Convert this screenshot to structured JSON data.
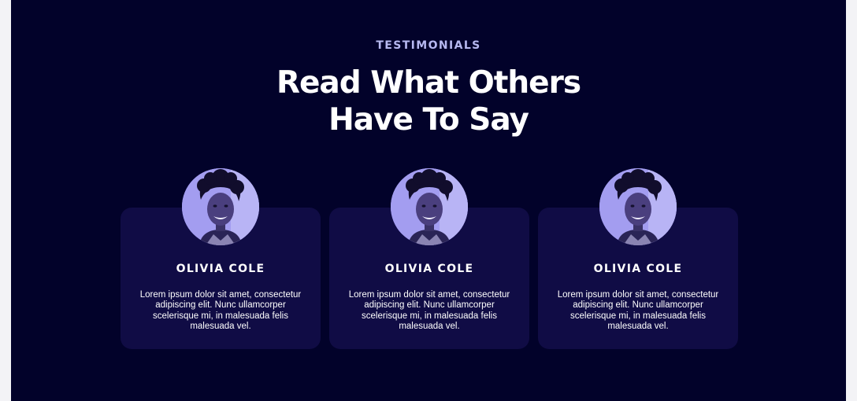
{
  "testimonials": {
    "eyebrow": "TESTIMONIALS",
    "headline_line1": "Read What Others",
    "headline_line2": "Have To Say",
    "items": [
      {
        "name": "OLIVIA COLE",
        "text": "Lorem ipsum dolor sit amet, consectetur adipiscing elit. Nunc ullamcorper scelerisque mi, in malesuada felis malesuada vel."
      },
      {
        "name": "OLIVIA COLE",
        "text": "Lorem ipsum dolor sit amet, consectetur adipiscing elit. Nunc ullamcorper scelerisque mi, in malesuada felis malesuada vel."
      },
      {
        "name": "OLIVIA COLE",
        "text": "Lorem ipsum dolor sit amet, consectetur adipiscing elit. Nunc ullamcorper scelerisque mi, in malesuada felis malesuada vel."
      }
    ]
  },
  "colors": {
    "section_bg": "#02022a",
    "card_bg": "#100c45",
    "eyebrow": "#b7b9f0",
    "avatar_tint": "#9b95ea"
  }
}
